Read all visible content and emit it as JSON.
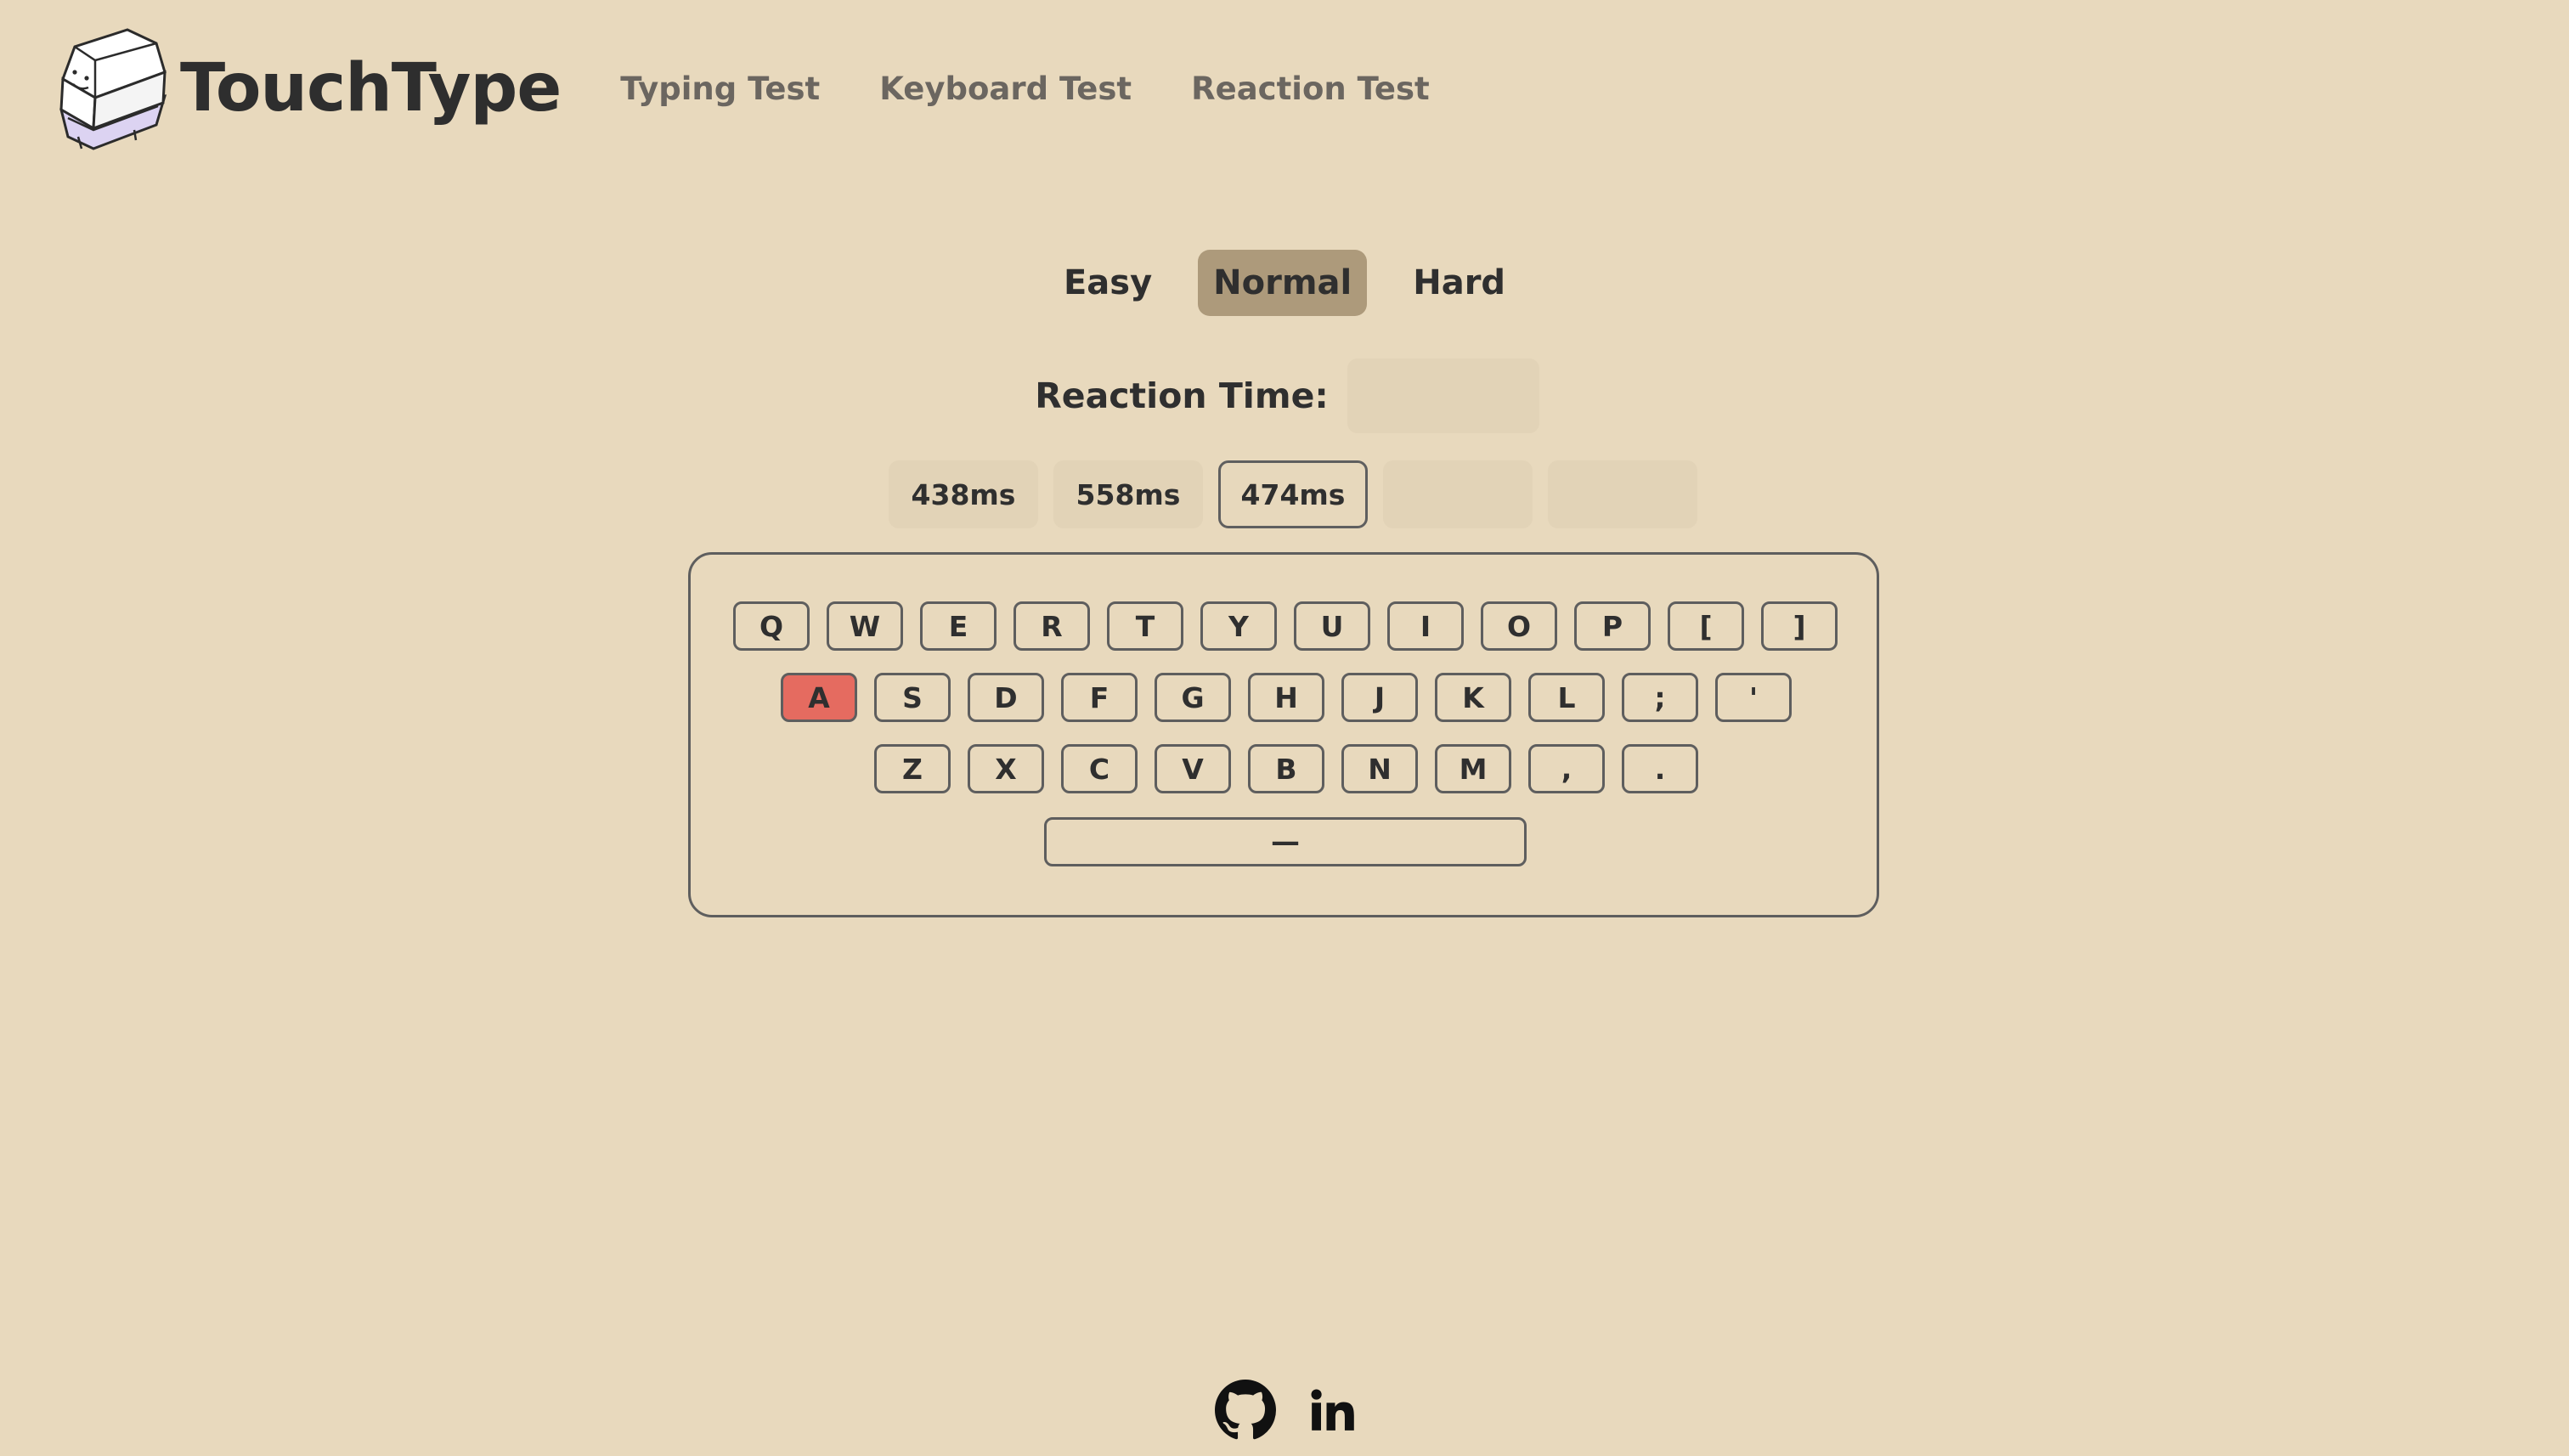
{
  "brand": {
    "name": "TouchType",
    "logo_icon": "keycap-mascot-icon"
  },
  "nav": {
    "items": [
      {
        "label": "Typing Test"
      },
      {
        "label": "Keyboard Test"
      },
      {
        "label": "Reaction Test"
      }
    ]
  },
  "difficulty": {
    "options": [
      "Easy",
      "Normal",
      "Hard"
    ],
    "selected": "Normal"
  },
  "reaction": {
    "label": "Reaction Time:",
    "value": "",
    "history": [
      "438ms",
      "558ms",
      "474ms",
      "",
      ""
    ],
    "current_index": 2
  },
  "keyboard": {
    "rows": [
      [
        "Q",
        "W",
        "E",
        "R",
        "T",
        "Y",
        "U",
        "I",
        "O",
        "P",
        "[",
        "]"
      ],
      [
        "A",
        "S",
        "D",
        "F",
        "G",
        "H",
        "J",
        "K",
        "L",
        ";",
        "'"
      ],
      [
        "Z",
        "X",
        "C",
        "V",
        "B",
        "N",
        "M",
        ",",
        "."
      ]
    ],
    "space_label": "—",
    "active_key": "A"
  },
  "footer": {
    "icons": [
      "github-icon",
      "linkedin-icon"
    ]
  },
  "colors": {
    "background": "#e8d9bd",
    "active_difficulty": "#ad9a7b",
    "active_key": "#e56b60",
    "empty_cell": "#e2d3b7"
  }
}
